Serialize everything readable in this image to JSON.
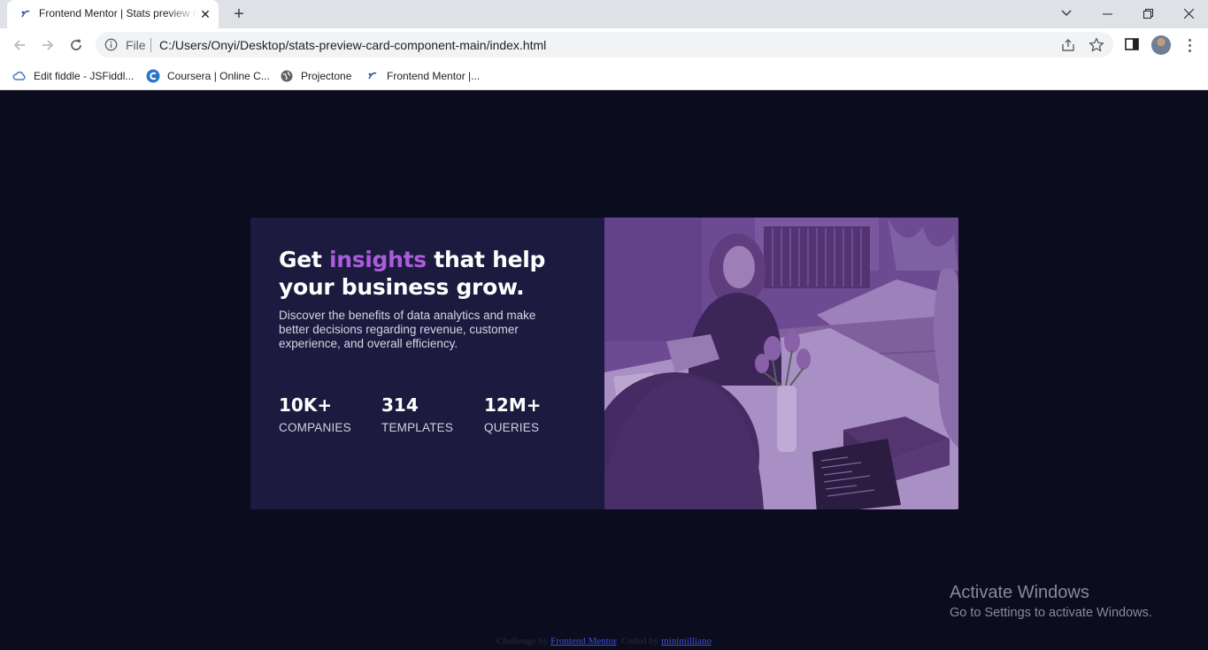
{
  "browser": {
    "tab_title": "Frontend Mentor | Stats preview card component",
    "omnibox_scheme": "File",
    "url": "C:/Users/Onyi/Desktop/stats-preview-card-component-main/index.html",
    "bookmarks": [
      {
        "label": "Edit fiddle - JSFiddl...",
        "icon": "cloud-icon"
      },
      {
        "label": "Coursera | Online C...",
        "icon": "coursera-icon"
      },
      {
        "label": "Projectone",
        "icon": "globe-icon"
      },
      {
        "label": "Frontend Mentor |...",
        "icon": "frontend-mentor-icon"
      }
    ]
  },
  "card": {
    "headline_before": "Get ",
    "headline_accent": "insights",
    "headline_after": " that help your business grow.",
    "description": "Discover the benefits of data analytics and make better decisions regarding revenue, customer experience, and overall efficiency.",
    "stats": [
      {
        "value": "10K+",
        "label": "COMPANIES"
      },
      {
        "value": "314",
        "label": "TEMPLATES"
      },
      {
        "value": "12M+",
        "label": "QUERIES"
      }
    ],
    "colors": {
      "background": "#0b0c1e",
      "card": "#1c1a3e",
      "accent": "#aa5cdb",
      "image_overlay": "#6a4d8c"
    }
  },
  "attribution": {
    "prefix": "Challenge by ",
    "link1": "Frontend Mentor",
    "middle": ". Coded by ",
    "link2": "minimilliano"
  },
  "windows_watermark": {
    "title": "Activate Windows",
    "subtitle": "Go to Settings to activate Windows."
  }
}
